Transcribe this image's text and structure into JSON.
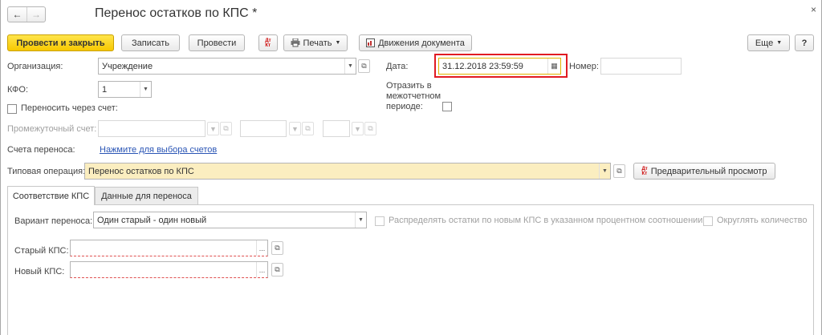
{
  "window": {
    "title": "Перенос остатков по КПС *",
    "nav_back": "←",
    "nav_forward": "→",
    "close": "×"
  },
  "toolbar": {
    "post_close": "Провести и закрыть",
    "save": "Записать",
    "post": "Провести",
    "print": "Печать",
    "movements": "Движения документа",
    "more": "Еще",
    "help": "?",
    "dtkt_icon": "dt-kt-icon",
    "print_icon": "printer-icon",
    "movements_icon": "register-icon"
  },
  "form": {
    "org_label": "Организация:",
    "org_value": "Учреждение",
    "date_label": "Дата:",
    "date_value": "31.12.2018 23:59:59",
    "number_label": "Номер:",
    "number_value": "",
    "kfo_label": "КФО:",
    "kfo_value": "1",
    "reflect_label_1": "Отразить в",
    "reflect_label_2": "межотчетном",
    "reflect_label_3": "периоде:",
    "transfer_via_label": "Переносить через счет:",
    "intermediate_label": "Промежуточный счет:",
    "accounts_label": "Счета переноса:",
    "accounts_link": "Нажмите для выбора счетов",
    "op_label": "Типовая операция:",
    "op_value": "Перенос остатков по КПС",
    "preview": "Предварительный просмотр"
  },
  "tabs": [
    {
      "label": "Соответствие КПС"
    },
    {
      "label": "Данные для переноса"
    }
  ],
  "tab_content": {
    "variant_label": "Вариант переноса:",
    "variant_value": "Один старый - один новый",
    "distribute_label": "Распределять остатки по новым КПС в указанном процентном соотношении",
    "round_label": "Округлять количество",
    "old_kps_label": "Старый КПС:",
    "old_kps_value": "",
    "new_kps_label": "Новый КПС:",
    "new_kps_value": ""
  },
  "colors": {
    "primary_button": "#f7c800",
    "highlight_box": "#e11b22",
    "link": "#2a55b5",
    "required_field": "#fbeec0"
  }
}
